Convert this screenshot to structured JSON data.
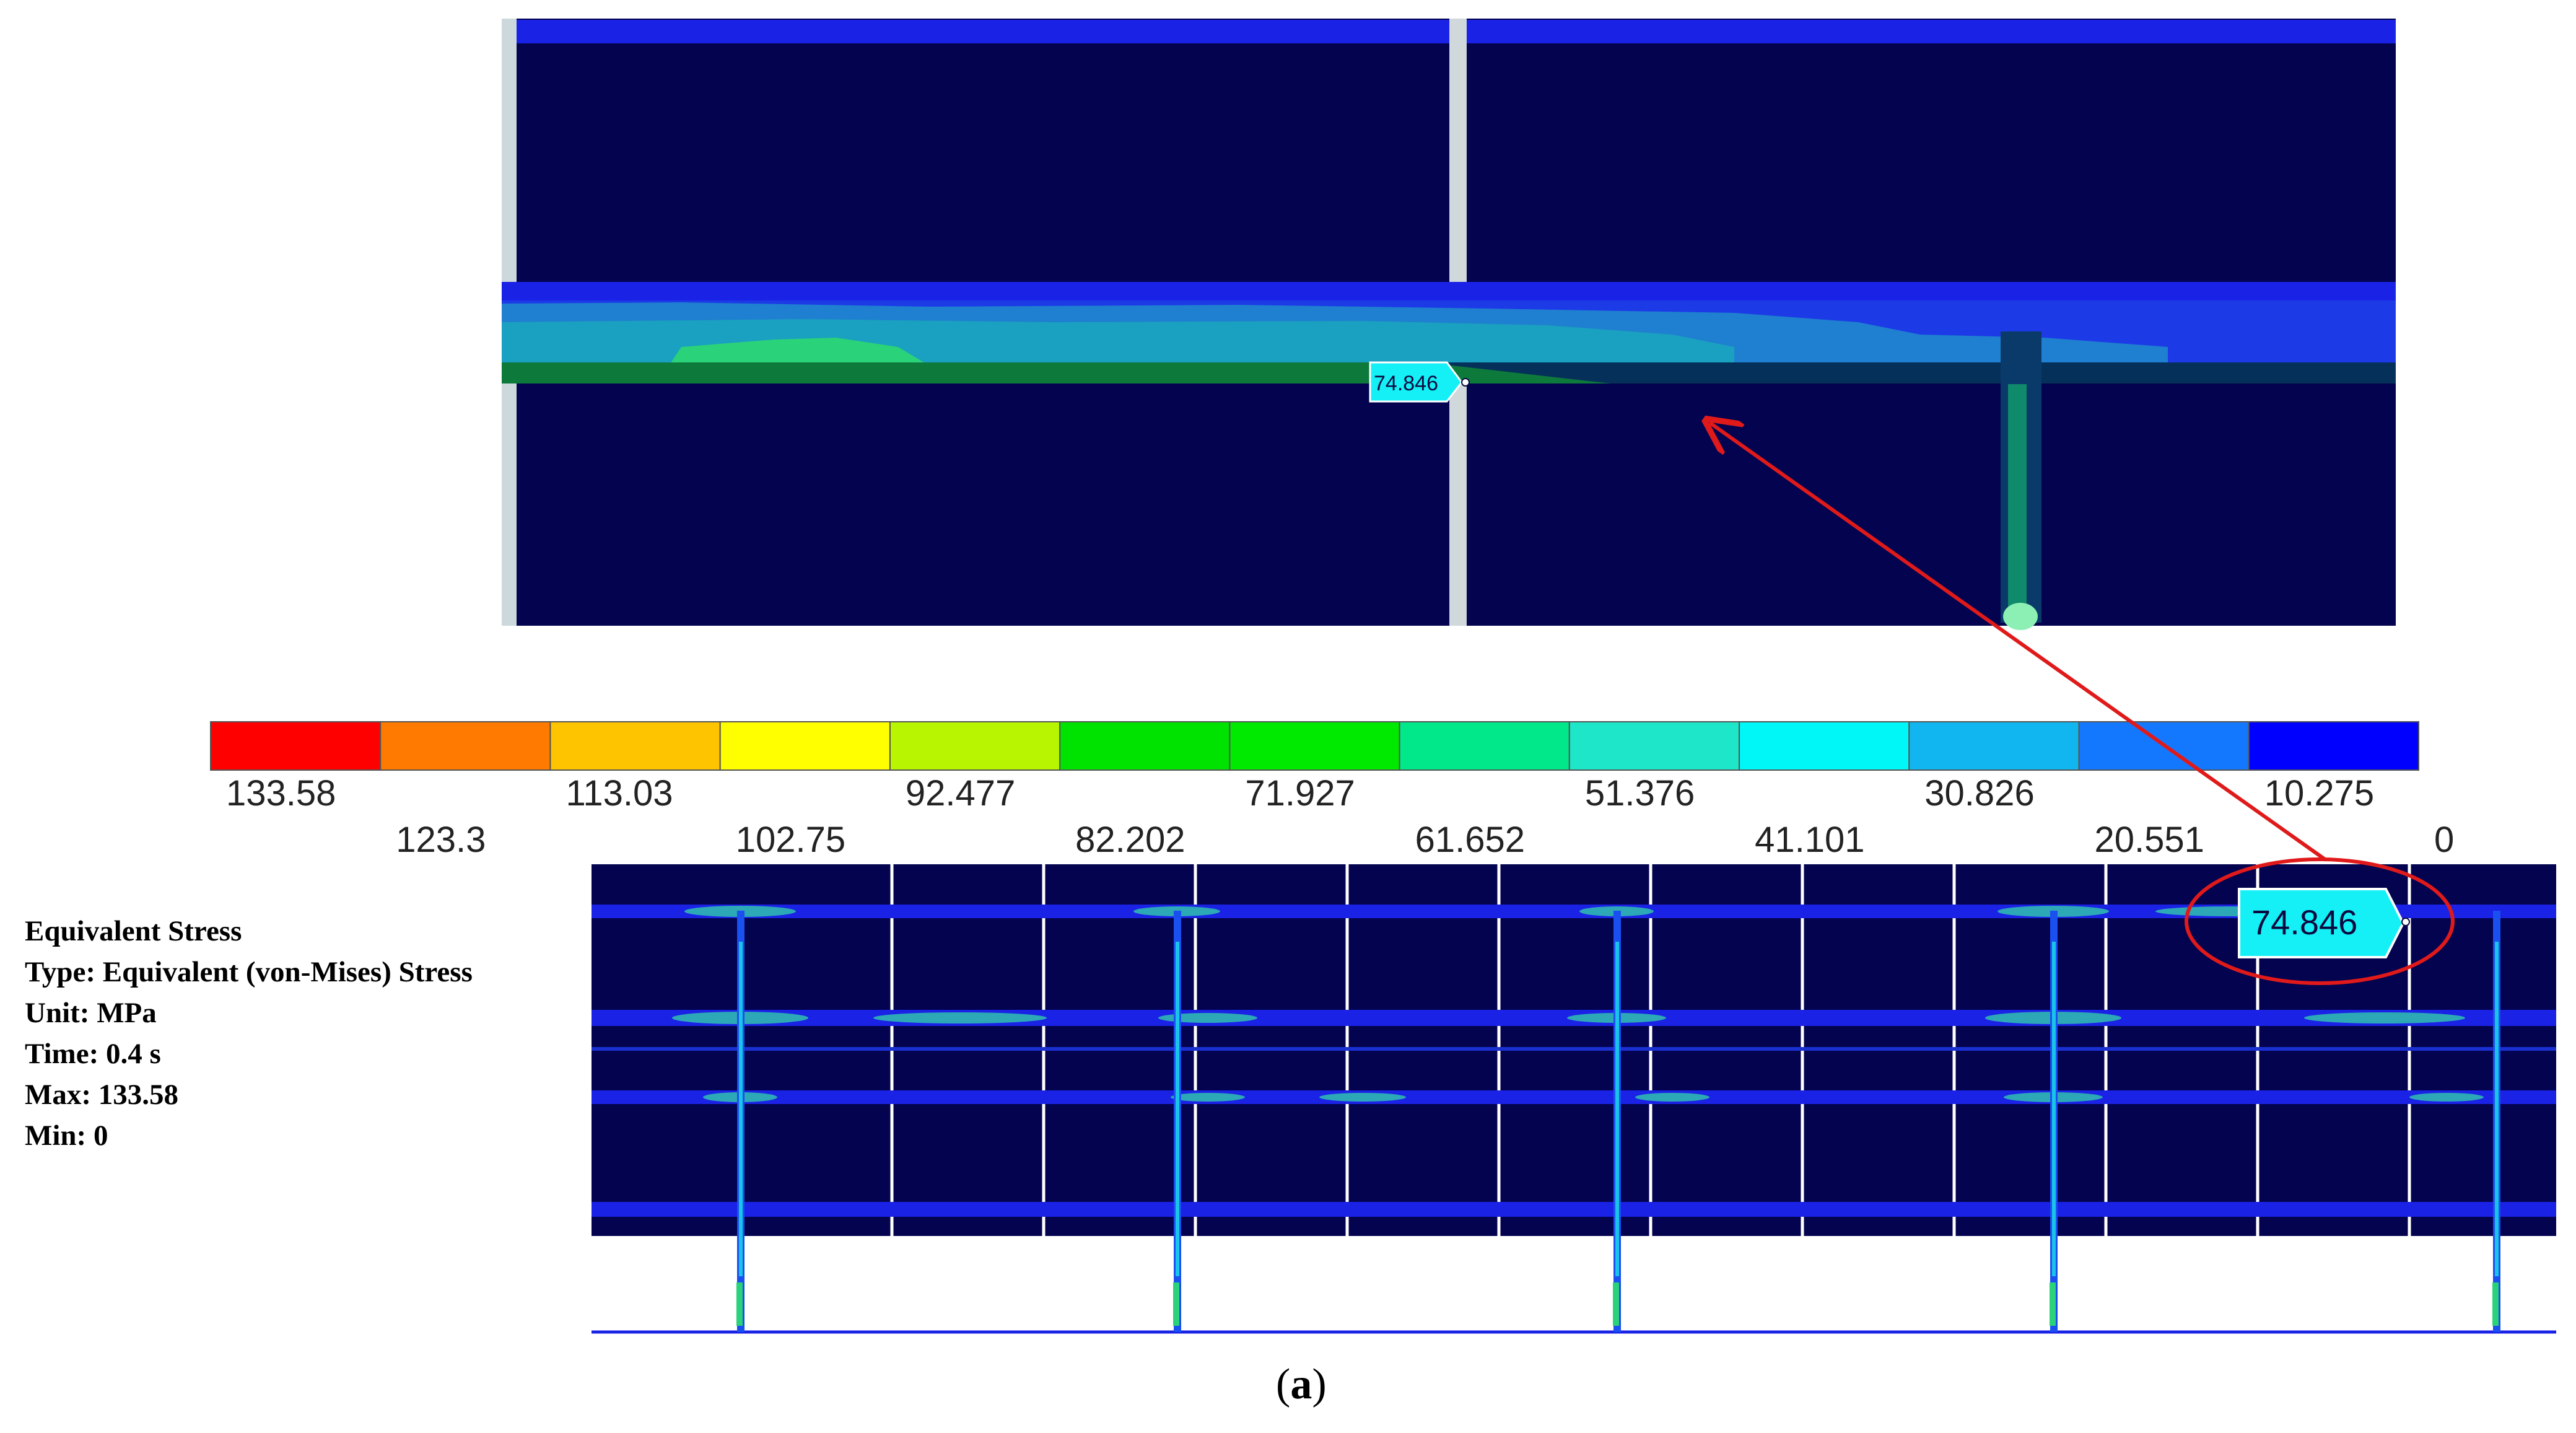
{
  "colors": {
    "background": "#03034f",
    "plate_blue": "#1a22e6",
    "divider": "#d0d8dc",
    "arrow": "#e01a1a",
    "probe_fill": "#14f0f5"
  },
  "legend": {
    "labels_row1": [
      "133.58",
      "113.03",
      "92.477",
      "71.927",
      "51.376",
      "30.826",
      "10.275"
    ],
    "labels_row2": [
      "123.3",
      "102.75",
      "82.202",
      "61.652",
      "41.101",
      "20.551",
      "0"
    ],
    "colors": [
      "#ff0000",
      "#ff7a00",
      "#ffc400",
      "#ffff00",
      "#b7f500",
      "#00e300",
      "#00ea00",
      "#00e88a",
      "#1ee6c8",
      "#00f7f7",
      "#11b6f0",
      "#1478ff",
      "#0000ff"
    ]
  },
  "zoom_view": {
    "probe_label": "74.846"
  },
  "full_view": {
    "probe_label": "74.846"
  },
  "info": {
    "title": "Equivalent Stress",
    "type": "Type: Equivalent (von-Mises) Stress",
    "unit": "Unit: MPa",
    "time": "Time: 0.4 s",
    "max": "Max: 133.58",
    "min": "Min: 0"
  },
  "caption": {
    "open": "(",
    "letter": "a",
    "close": ")"
  }
}
